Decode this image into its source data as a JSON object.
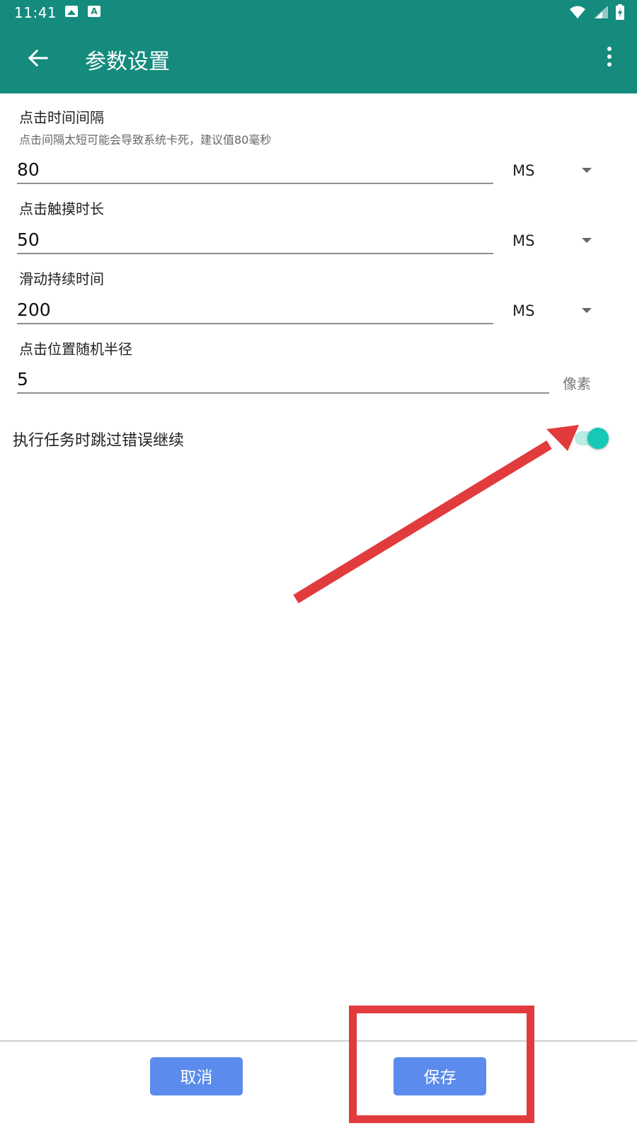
{
  "status_bar": {
    "time": "11:41",
    "icons": [
      "image-icon",
      "a-icon",
      "wifi-icon",
      "signal-icon",
      "battery-icon"
    ]
  },
  "app_bar": {
    "title": "参数设置",
    "back_icon": "back-arrow-icon",
    "menu_icon": "more-vert-icon"
  },
  "settings": {
    "click_interval": {
      "label": "点击时间间隔",
      "hint": "点击间隔太短可能会导致系统卡死，建议值80毫秒",
      "value": "80",
      "unit": "MS"
    },
    "touch_duration": {
      "label": "点击触摸时长",
      "value": "50",
      "unit": "MS"
    },
    "swipe_duration": {
      "label": "滑动持续时间",
      "value": "200",
      "unit": "MS"
    },
    "random_radius": {
      "label": "点击位置随机半径",
      "value": "5",
      "unit": "像素"
    },
    "skip_errors": {
      "label": "执行任务时跳过错误继续",
      "enabled": true
    }
  },
  "buttons": {
    "cancel": "取消",
    "save": "保存"
  },
  "colors": {
    "app_bar": "#148b7d",
    "button": "#5b8bec",
    "switch_on": "#18c8b6",
    "annotation": "#e13b3d"
  }
}
